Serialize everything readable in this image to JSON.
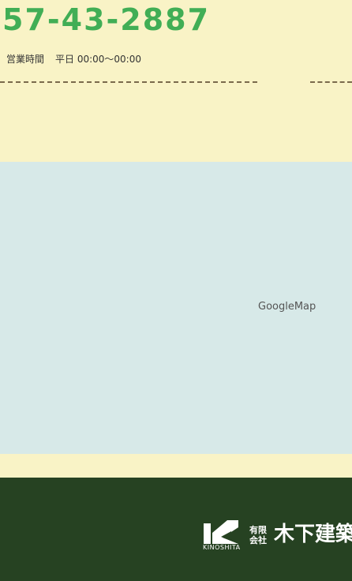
{
  "contact": {
    "phone": "57-43-2887",
    "hours_label": "営業時間",
    "hours_value": "平日 00:00〜00:00"
  },
  "map": {
    "label": "GoogleMap"
  },
  "footer": {
    "logo_text": "KINOSHITA",
    "company_prefix": "有限会社",
    "company_name": "木下建築"
  },
  "colors": {
    "cream": "#f9f3c6",
    "phone_green": "#41ae55",
    "map_bg": "#d7e9e8",
    "footer_green": "#264222"
  },
  "icons": {
    "logo": "kinoshita-k-logo-icon"
  }
}
